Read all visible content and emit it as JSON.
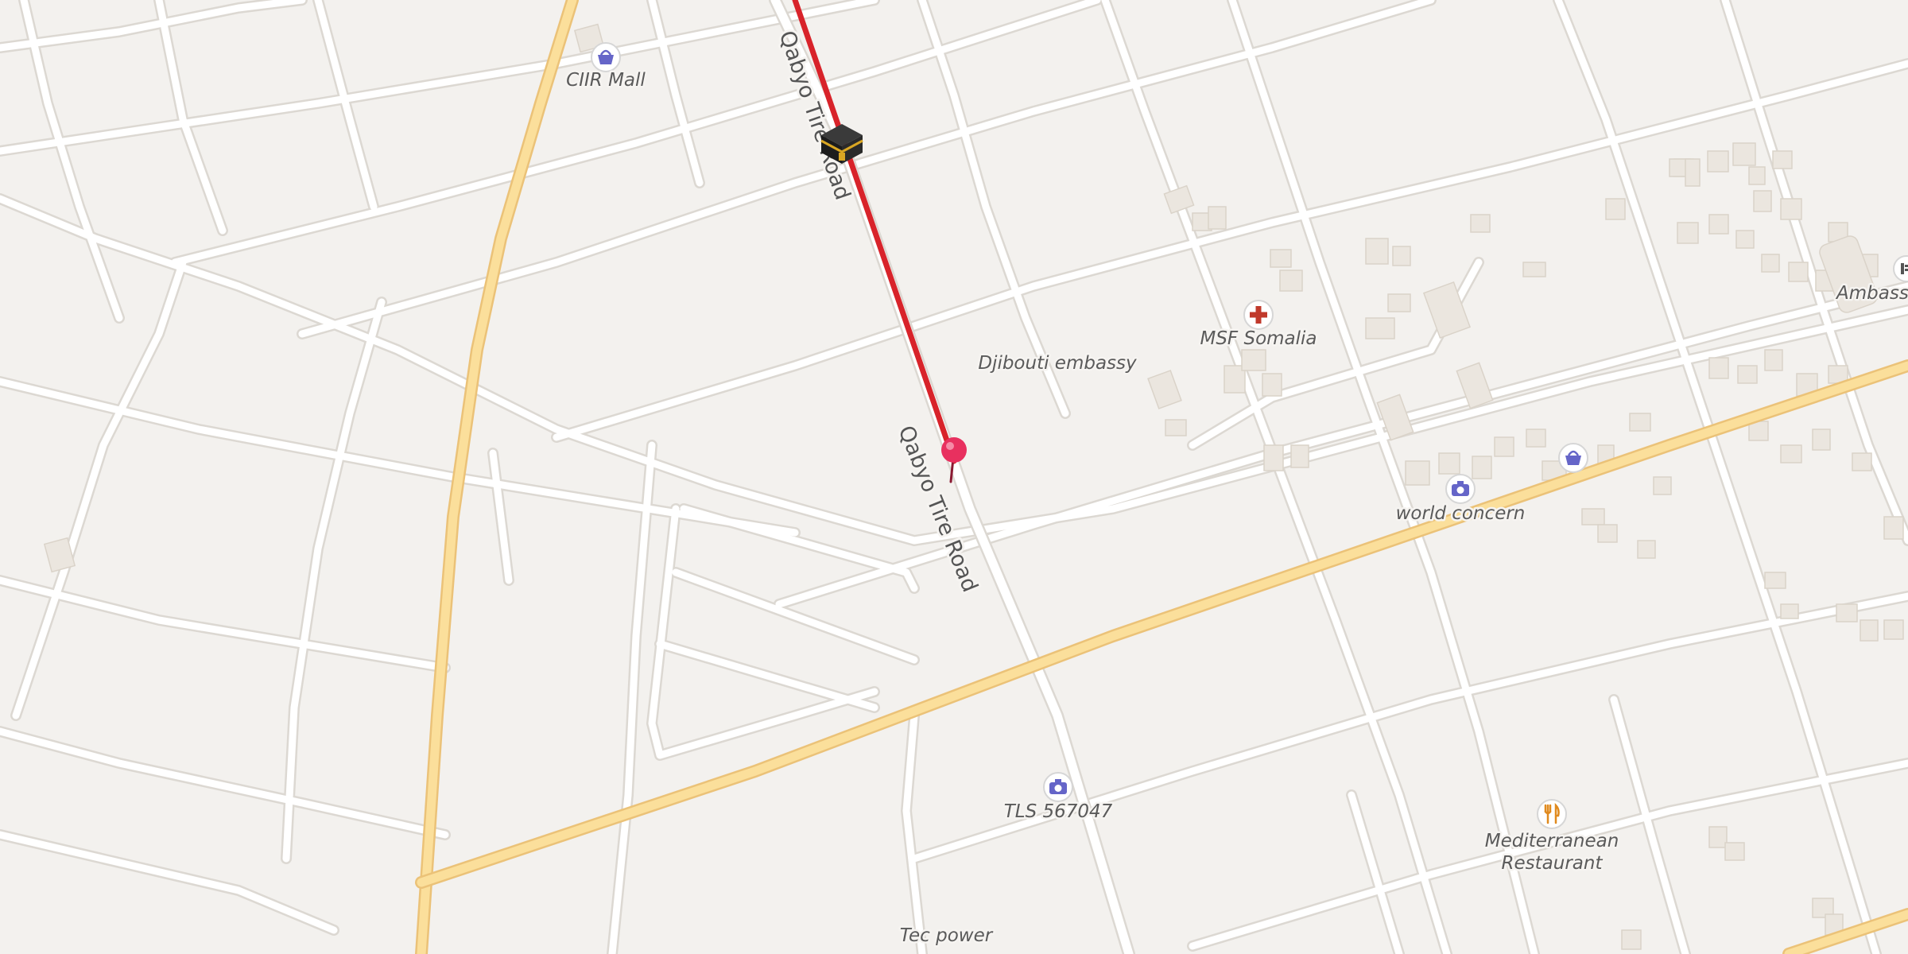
{
  "map": {
    "streets": [
      {
        "name": "Qabyo Tire Road"
      },
      {
        "name": "Qabyo Tire Road"
      }
    ],
    "places": [
      {
        "name": "CIIR Mall",
        "icon": "shopping-basket-icon"
      },
      {
        "name": "MSF Somalia",
        "icon": "medical-cross-icon"
      },
      {
        "name": "Djibouti embassy",
        "icon": ""
      },
      {
        "name": "world concern",
        "icon": "camera-icon"
      },
      {
        "name": "TLS 567047",
        "icon": "camera-icon"
      },
      {
        "name": "Mediterranean",
        "icon": "restaurant-icon"
      },
      {
        "name": "Restaurant",
        "icon": ""
      },
      {
        "name": "Tec power",
        "icon": ""
      },
      {
        "name": "Ambassa",
        "icon": "embassy-icon"
      }
    ],
    "extra_icons": [
      "shopping-basket-icon",
      "kaaba-icon",
      "location-pin-icon"
    ],
    "colors": {
      "background": "#f3f1ee",
      "minor_road": "#ffffff",
      "main_road": "#fbdf9b",
      "main_road_casing": "#ebc278",
      "route": "#d8232a",
      "pin": "#e8305f",
      "poi_icon": "#6565c8"
    }
  }
}
